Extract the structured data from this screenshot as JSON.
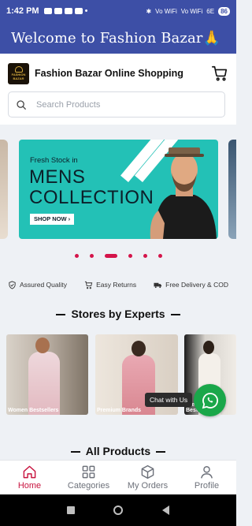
{
  "status": {
    "time": "1:42 PM",
    "signal1": "Vo WiFi",
    "signal2": "Vo WiFi",
    "wifi": "6E",
    "battery": "86"
  },
  "appbar": {
    "title": "Welcome to Fashion Bazar🙏"
  },
  "header": {
    "brand_name": "Fashion Bazar Online Shopping",
    "logo_text": "FASHION BAZAR",
    "cart_icon": "cart-icon"
  },
  "search": {
    "placeholder": "Search Products"
  },
  "banner": {
    "kicker": "Fresh Stock in",
    "line1": "MENS",
    "line2": "COLLECTION",
    "button": "SHOP NOW",
    "background": "#23c1b6",
    "slide_count": 6,
    "active_slide": 3
  },
  "features": [
    {
      "label": "Assured Quality",
      "icon": "shield-check-icon"
    },
    {
      "label": "Easy Returns",
      "icon": "cart-return-icon"
    },
    {
      "label": "Free Delivery & COD",
      "icon": "truck-icon"
    }
  ],
  "sections": {
    "stores_title": "Stores by Experts",
    "products_title": "All Products"
  },
  "stores": [
    {
      "label": "Women Bestsellers"
    },
    {
      "label": "Premium Brands"
    },
    {
      "label": "Premium Bestsellers"
    }
  ],
  "chat": {
    "label": "Chat with Us",
    "icon": "whatsapp-icon",
    "color": "#1aa74a"
  },
  "bottom_nav": [
    {
      "label": "Home",
      "icon": "home-icon",
      "active": true
    },
    {
      "label": "Categories",
      "icon": "grid-icon",
      "active": false
    },
    {
      "label": "My Orders",
      "icon": "box-icon",
      "active": false
    },
    {
      "label": "Profile",
      "icon": "person-icon",
      "active": false
    }
  ],
  "colors": {
    "primary": "#3d4fa6",
    "accent": "#c8143f"
  }
}
